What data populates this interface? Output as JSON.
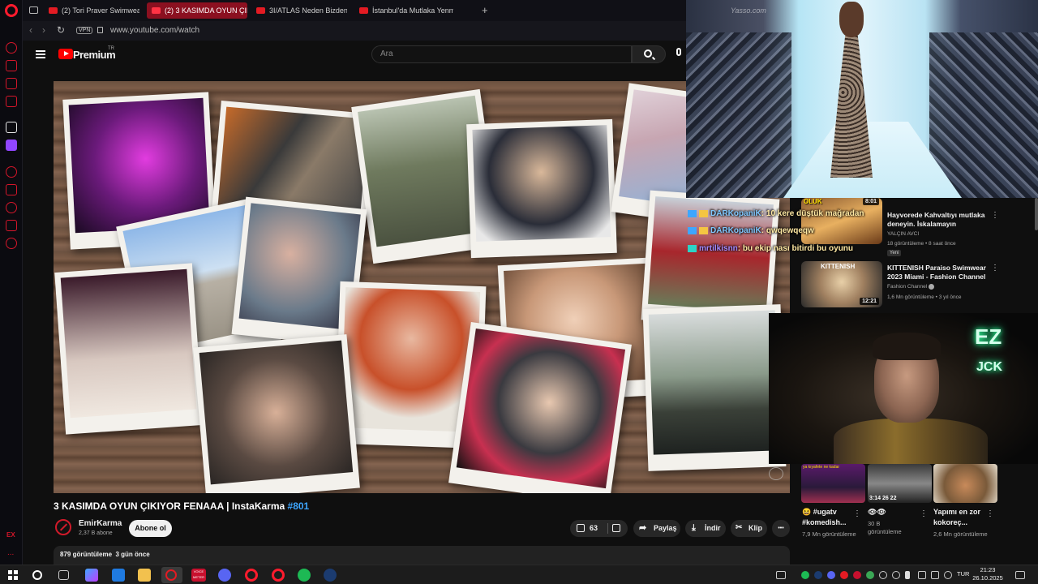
{
  "browser": {
    "tabs": [
      {
        "label": "(2) Tori Praver Swimwear",
        "active": false
      },
      {
        "label": "(2) 3 KASIMDA OYUN ÇIK",
        "active": true
      },
      {
        "label": "3I/ATLAS Neden Bizden",
        "active": false
      },
      {
        "label": "İstanbul'da Mutlaka Yenm",
        "active": false
      }
    ],
    "vpn_label": "VPN",
    "url": "www.youtube.com/watch",
    "sidebar_footer": "EX",
    "sidebar_more": "..."
  },
  "youtube": {
    "brand": "Premium",
    "country_code": "TR",
    "search_placeholder": "Ara",
    "video": {
      "title": "3 KASIMDA OYUN ÇIKIYOR FENAAA | InstaKarma",
      "hashtag": "#801",
      "channel_name": "EmirKarma",
      "channel_subs": "2,37 B abone",
      "subscribe_label": "Abone ol",
      "likes": "63",
      "share_label": "Paylaş",
      "download_label": "İndir",
      "clip_label": "Klip",
      "more_label": "•••",
      "views": "879 görüntüleme",
      "age": "3 gün önce"
    },
    "recommendations": [
      {
        "title": "Hayvorede Kahvaltıyı mutlaka deneyin. İskalamayın",
        "channel": "YALÇIN AVCI",
        "meta": "18 görüntüleme • 8 saat önce",
        "badge": "Yeni",
        "duration": "8:01",
        "thumb_label": "OLUK"
      },
      {
        "title": "KITTENISH Paraiso Swimwear 2023 Miami - Fashion Channel",
        "channel": "Fashion Channel",
        "meta": "1,6 Mn görüntüleme • 3 yıl önce",
        "duration": "12:21",
        "thumb_label": "KITTENISH"
      }
    ],
    "shorts": [
      {
        "title": "😆 #ugatv #komedish...",
        "views": "7,9 Mn görüntüleme",
        "thumb_caption": "ya kıyafete ne kadar"
      },
      {
        "title": "👁👁",
        "views": "30 B görüntüleme",
        "thumb_caption": "3:14 26 22"
      },
      {
        "title": "Yapımı en zor kokoreç...",
        "views": "2,6 Mn görüntüleme",
        "thumb_caption": ""
      }
    ]
  },
  "overlay": {
    "fashion_watermark": "Yasso.com",
    "chat": [
      {
        "user": "DARKopaniK",
        "message": "10 kere düştük mağradan"
      },
      {
        "user": "DARKopaniK",
        "message": "qwqewqeqw"
      },
      {
        "user": "mrtilkisnn",
        "message": "bu ekip nası bitirdi bu oyunu"
      }
    ],
    "webcam_sign": "EZ",
    "webcam_sign2": "JCK"
  },
  "taskbar": {
    "lang": "TUR",
    "time": "21:23",
    "date": "26.10.2025",
    "app_badge": "VOICE METER"
  },
  "colors": {
    "accent": "#ff0000",
    "opera": "#ff1b2d",
    "link": "#3ea6ff"
  }
}
